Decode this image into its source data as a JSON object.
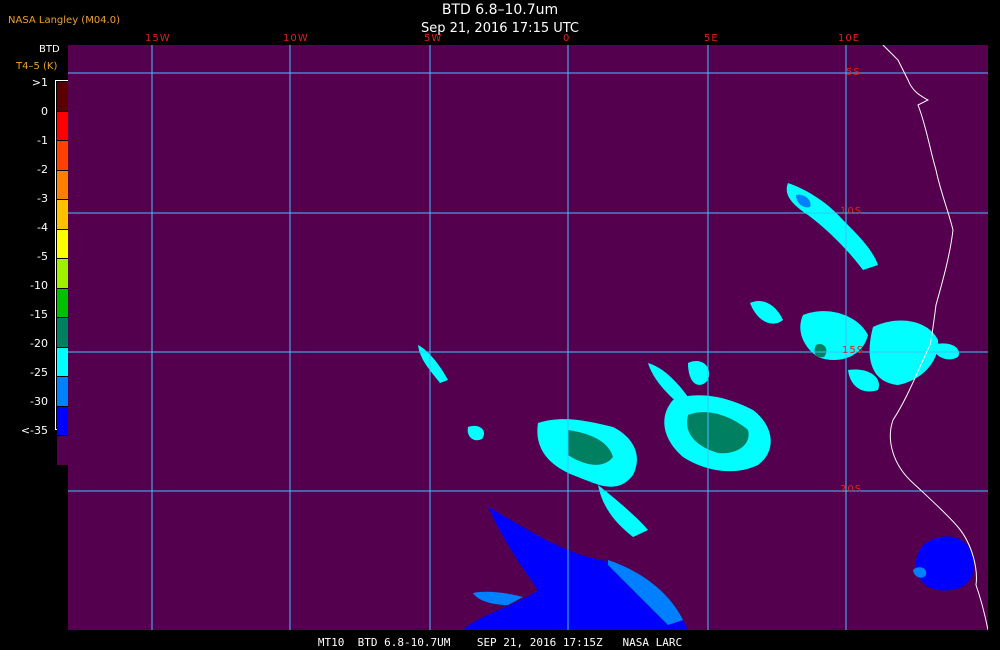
{
  "header": {
    "logo_text": "NASA Langley (M04.0)",
    "title": "BTD 6.8–10.7um",
    "datetime": "Sep 21, 2016 17:15 UTC"
  },
  "legend": {
    "line1": "BTD",
    "line2": "T4–5 (K)",
    "entries": [
      {
        "label": ">1",
        "color": "#5a0000"
      },
      {
        "label": "0",
        "color": "#ff0000"
      },
      {
        "label": "-1",
        "color": "#ff4000"
      },
      {
        "label": "-2",
        "color": "#ff8000"
      },
      {
        "label": "-3",
        "color": "#ffc000"
      },
      {
        "label": "-4",
        "color": "#ffff00"
      },
      {
        "label": "-5",
        "color": "#a0f000"
      },
      {
        "label": "-10",
        "color": "#00c000"
      },
      {
        "label": "-15",
        "color": "#008060"
      },
      {
        "label": "-20",
        "color": "#00ffff"
      },
      {
        "label": "-25",
        "color": "#0080ff"
      },
      {
        "label": "-30",
        "color": "#0000ff"
      },
      {
        "label": "<-35",
        "color": "#55004f"
      }
    ]
  },
  "map": {
    "background_color": "#55004f",
    "grid_color": "#40c0ff",
    "coast_color": "#ffffff",
    "longitude_labels": [
      "15W",
      "10W",
      "5W",
      "0",
      "5E",
      "10E"
    ],
    "latitude_labels": [
      "5S",
      "10S",
      "15S",
      "20S"
    ]
  },
  "footer": {
    "text": "MT10  BTD 6.8-10.7UM    SEP 21, 2016 17:15Z   NASA LARC"
  }
}
